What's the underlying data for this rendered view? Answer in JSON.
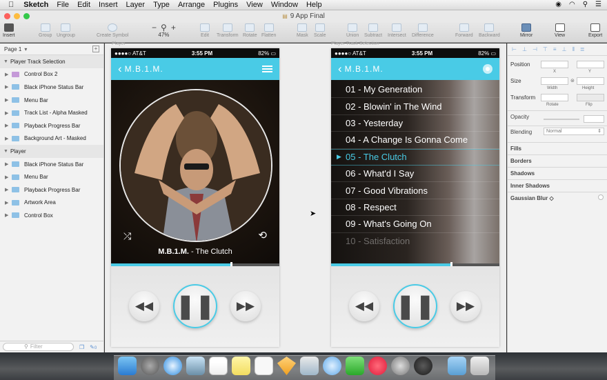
{
  "menubar": {
    "app_name": "Sketch",
    "items": [
      "File",
      "Edit",
      "Insert",
      "Layer",
      "Type",
      "Arrange",
      "Plugins",
      "View",
      "Window",
      "Help"
    ]
  },
  "window": {
    "title": "9 App Final"
  },
  "toolbar": {
    "insert": "Insert",
    "group": "Group",
    "ungroup": "Ungroup",
    "create_symbol": "Create Symbol",
    "zoom_value": "47%",
    "edit": "Edit",
    "transform": "Transform",
    "rotate": "Rotate",
    "flatten": "Flatten",
    "mask": "Mask",
    "scale": "Scale",
    "union": "Union",
    "subtract": "Subtract",
    "intersect": "Intersect",
    "difference": "Difference",
    "forward": "Forward",
    "backward": "Backward",
    "mirror": "Mirror",
    "view": "View",
    "export": "Export"
  },
  "layers": {
    "page": "Page 1",
    "groups": [
      {
        "name": "Player Track Selection",
        "children": [
          {
            "name": "Control Box 2",
            "symbol": true
          },
          {
            "name": "Black iPhone Status Bar"
          },
          {
            "name": "Menu Bar"
          },
          {
            "name": "Track List - Alpha Masked"
          },
          {
            "name": "Playback Progress Bar"
          },
          {
            "name": "Background Art - Masked"
          }
        ]
      },
      {
        "name": "Player",
        "children": [
          {
            "name": "Black iPhone Status Bar"
          },
          {
            "name": "Menu Bar"
          },
          {
            "name": "Playback Progress Bar"
          },
          {
            "name": "Artwork Area"
          },
          {
            "name": "Control Box"
          }
        ]
      }
    ],
    "filter_placeholder": "Filter",
    "filter_count": "0"
  },
  "artboards": {
    "player_label": "Player",
    "tracks_label": "Player Track Selection"
  },
  "status_bar": {
    "carrier": "●●●●○ AT&T",
    "time": "3:55 PM",
    "battery": "82%"
  },
  "player": {
    "nav_title": "M.B.1.M.",
    "now_playing_artist": "M.B.1.M.",
    "now_playing_track": " - The Clutch",
    "progress": 0.71,
    "accent": "#49cbe6"
  },
  "tracklist": {
    "nav_title": "M.B.1.M.",
    "progress": 0.71,
    "tracks": [
      "01 - My Generation",
      "02 - Blowin' in The Wind",
      "03 - Yesterday",
      "04 - A Change Is Gonna Come",
      "05 - The Clutch",
      "06 - What'd I Say",
      "07 - Good Vibrations",
      "08 - Respect",
      "09 - What's Going On",
      "10 - Satisfaction"
    ],
    "active_index": 4
  },
  "inspector": {
    "position": "Position",
    "x": "X",
    "y": "Y",
    "size": "Size",
    "width": "Width",
    "height": "Height",
    "transform": "Transform",
    "rotate": "Rotate",
    "flip": "Flip",
    "opacity": "Opacity",
    "blending": "Blending",
    "blending_value": "Normal",
    "sections": [
      "Fills",
      "Borders",
      "Shadows",
      "Inner Shadows",
      "Gaussian Blur ◇"
    ]
  }
}
